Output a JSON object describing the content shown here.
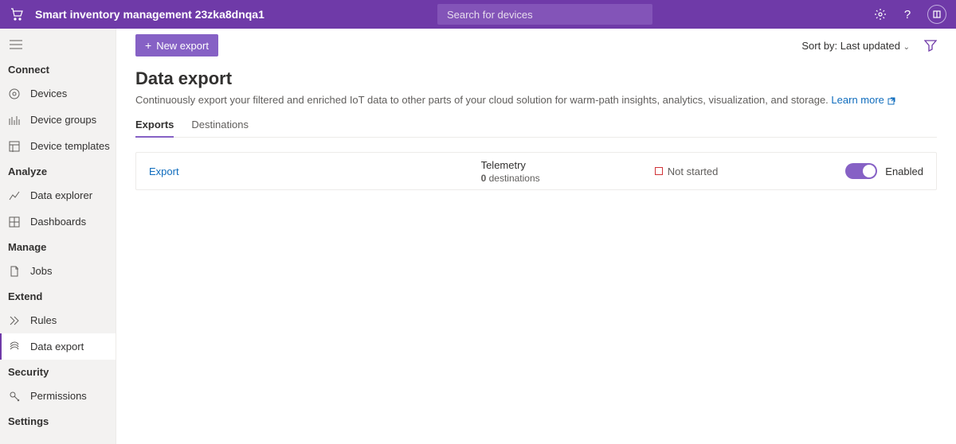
{
  "header": {
    "title": "Smart inventory management 23zka8dnqa1",
    "search_placeholder": "Search for devices"
  },
  "sidebar": {
    "sections": {
      "connect": "Connect",
      "analyze": "Analyze",
      "manage": "Manage",
      "extend": "Extend",
      "security": "Security",
      "settings": "Settings"
    },
    "items": {
      "devices": "Devices",
      "device_groups": "Device groups",
      "device_templates": "Device templates",
      "data_explorer": "Data explorer",
      "dashboards": "Dashboards",
      "jobs": "Jobs",
      "rules": "Rules",
      "data_export": "Data export",
      "permissions": "Permissions"
    }
  },
  "cmdbar": {
    "new_export": "New export",
    "sort_by_label": "Sort by:",
    "sort_by_value": "Last updated"
  },
  "page": {
    "title": "Data export",
    "subtitle": "Continuously export your filtered and enriched IoT data to other parts of your cloud solution for warm-path insights, analytics, visualization, and storage.",
    "learn_more": "Learn more"
  },
  "tabs": {
    "exports": "Exports",
    "destinations": "Destinations"
  },
  "row": {
    "name": "Export",
    "telemetry_title": "Telemetry",
    "dest_count": "0",
    "dest_label": " destinations",
    "status": "Not started",
    "enabled_label": "Enabled"
  }
}
